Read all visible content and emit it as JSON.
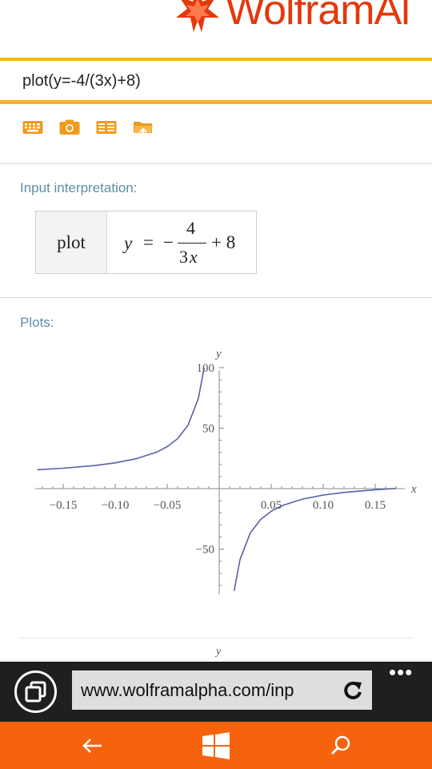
{
  "header": {
    "logo_text": "WolframAl"
  },
  "search": {
    "query": "plot(y=-4/(3x)+8)"
  },
  "toolbar": {
    "icons": [
      "keyboard-icon",
      "camera-icon",
      "examples-icon",
      "folder-upload-icon"
    ],
    "accent": "#f19a1e"
  },
  "interpretation": {
    "title": "Input interpretation:",
    "left_label": "plot",
    "formula": {
      "lhs": "y",
      "eq": "=",
      "minus": "−",
      "numerator": "4",
      "denominator_num": "3",
      "denominator_var": "x",
      "tail": "+ 8"
    }
  },
  "plots": {
    "title": "Plots:",
    "second_plot_peek_label": "y"
  },
  "chart_data": {
    "type": "line",
    "function": "y = -4/(3x) + 8",
    "title": "",
    "xlabel": "x",
    "ylabel": "y",
    "xlim": [
      -0.175,
      0.175
    ],
    "ylim": [
      -85,
      105
    ],
    "xticks": [
      -0.15,
      -0.1,
      -0.05,
      0.05,
      0.1,
      0.15
    ],
    "xtick_labels": [
      "−0.15",
      "−0.10",
      "−0.05",
      "0.05",
      "0.10",
      "0.15"
    ],
    "yticks": [
      100,
      50,
      -50
    ],
    "ytick_labels": [
      "100",
      "50",
      "−50"
    ],
    "series": [
      {
        "x": [
          -0.175,
          -0.15,
          -0.12,
          -0.1,
          -0.08,
          -0.06,
          -0.05,
          -0.04,
          -0.03,
          -0.02,
          -0.0145
        ],
        "y": [
          15.6,
          16.9,
          19.1,
          21.3,
          24.7,
          30.2,
          34.7,
          41.3,
          52.4,
          74.7,
          100
        ]
      },
      {
        "x": [
          0.0144,
          0.02,
          0.03,
          0.04,
          0.05,
          0.06,
          0.08,
          0.1,
          0.12,
          0.15,
          0.17
        ],
        "y": [
          -84.6,
          -58.7,
          -36.4,
          -25.3,
          -18.7,
          -14.2,
          -8.7,
          -5.3,
          -3.1,
          -0.9,
          0.2
        ]
      }
    ],
    "line_color": "#5b5fa8"
  },
  "browser": {
    "url": "www.wolframalpha.com/inp",
    "more": "•••"
  },
  "colors": {
    "accent_orange": "#f7630c",
    "search_border": "#f7b32b",
    "pod_title": "#5e8fa3",
    "logo_red": "#e4380d"
  }
}
